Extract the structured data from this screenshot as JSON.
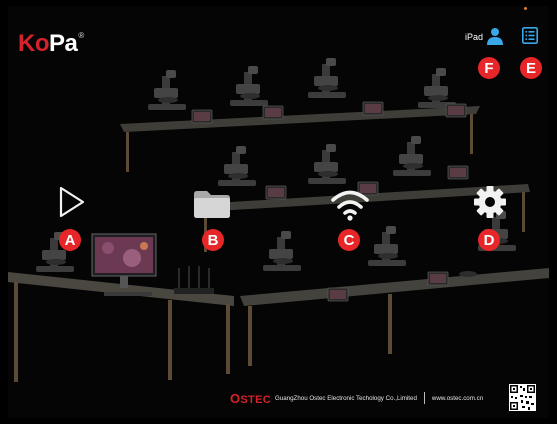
{
  "logo": {
    "text_ko": "Ko",
    "text_pa": "Pa",
    "registered": "®"
  },
  "header": {
    "device_name": "iPad"
  },
  "menu": [
    {
      "id": "A",
      "badge": "A",
      "icon": "play-icon",
      "label": ""
    },
    {
      "id": "B",
      "badge": "B",
      "icon": "folder-icon",
      "label": ""
    },
    {
      "id": "C",
      "badge": "C",
      "icon": "wifi-icon",
      "label": ""
    },
    {
      "id": "D",
      "badge": "D",
      "icon": "gear-icon",
      "label": ""
    },
    {
      "id": "E",
      "badge": "E",
      "icon": "list-icon",
      "label": ""
    },
    {
      "id": "F",
      "badge": "F",
      "icon": "user-icon",
      "label": ""
    }
  ],
  "footer": {
    "brand_first": "O",
    "brand_rest": "STEC",
    "company": "GuangZhou Ostec Electronic Techology Co.,Limited",
    "url": "www.ostec.com.cn"
  },
  "colors": {
    "logo_ko": "#d4222a",
    "logo_pa": "#ffffff",
    "badge": "#e62628",
    "accent_blue": "#3aa8e8",
    "icon_white": "#f2f2f2",
    "folder": "#cfcfcf",
    "footer_brand": "#d4222a"
  },
  "background_image": "classroom-microscope-lab"
}
